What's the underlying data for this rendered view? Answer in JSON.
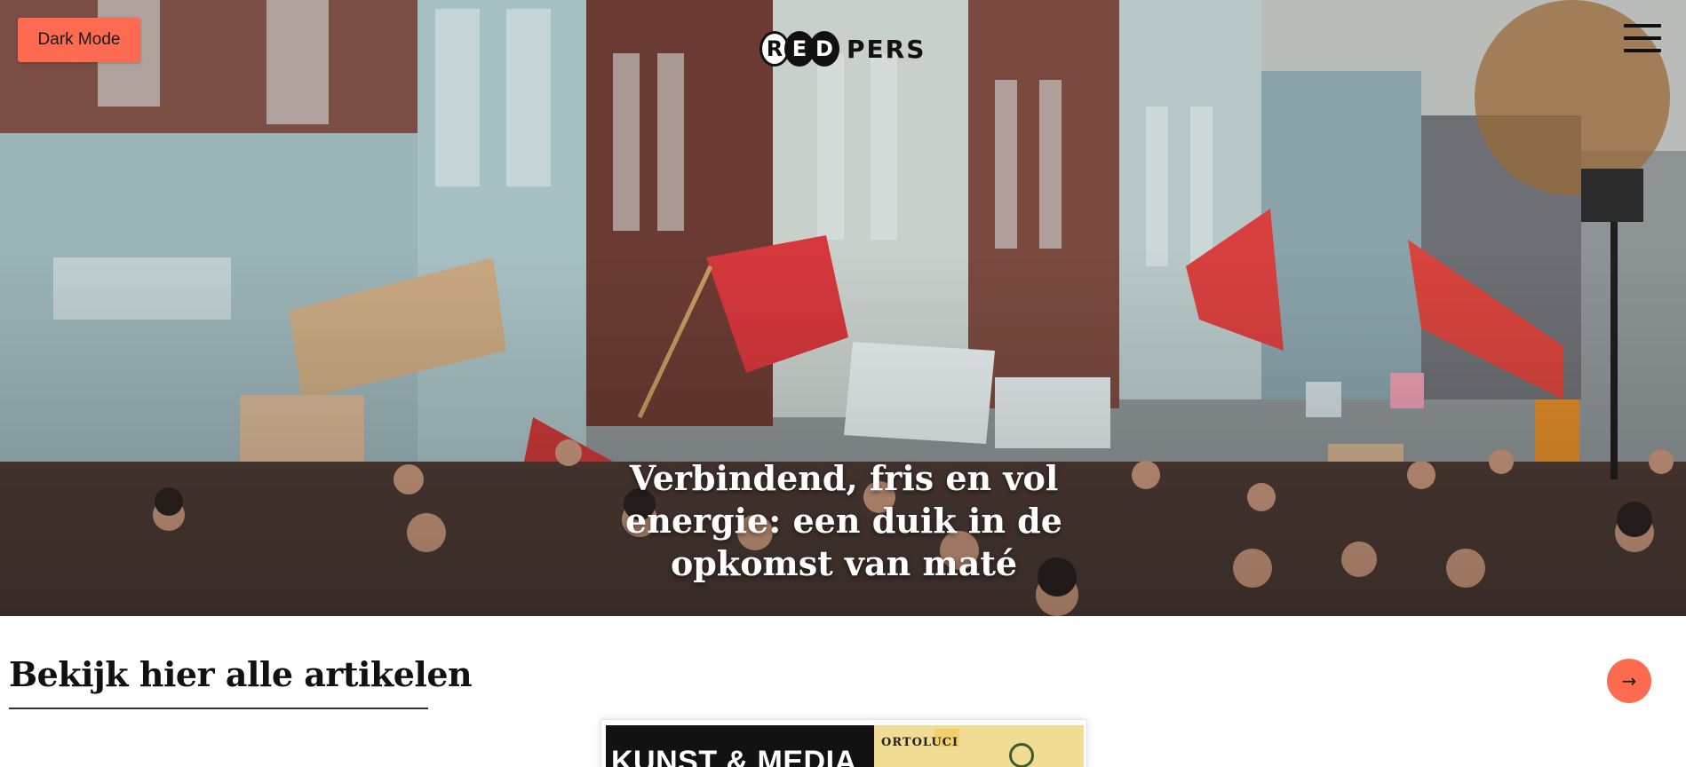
{
  "header": {
    "dark_mode_label": "Dark Mode",
    "logo": {
      "letters": [
        "R",
        "E",
        "D"
      ],
      "word": "PERS"
    },
    "menu_icon": "hamburger-menu-icon"
  },
  "hero": {
    "title": "Verbindend, fris en vol energie: een duik in de opkomst van maté",
    "image_alt": "protest-march-crowd-with-signs-and-red-flags"
  },
  "articles_section": {
    "title": "Bekijk hier alle artikelen",
    "arrow_icon": "arrow-right-icon"
  },
  "featured_card": {
    "category": "KUNST & MEDIA",
    "image_brand_text": "ORTOLUCI"
  },
  "colors": {
    "accent": "#ff6b50",
    "text": "#111111",
    "background": "#ffffff"
  }
}
